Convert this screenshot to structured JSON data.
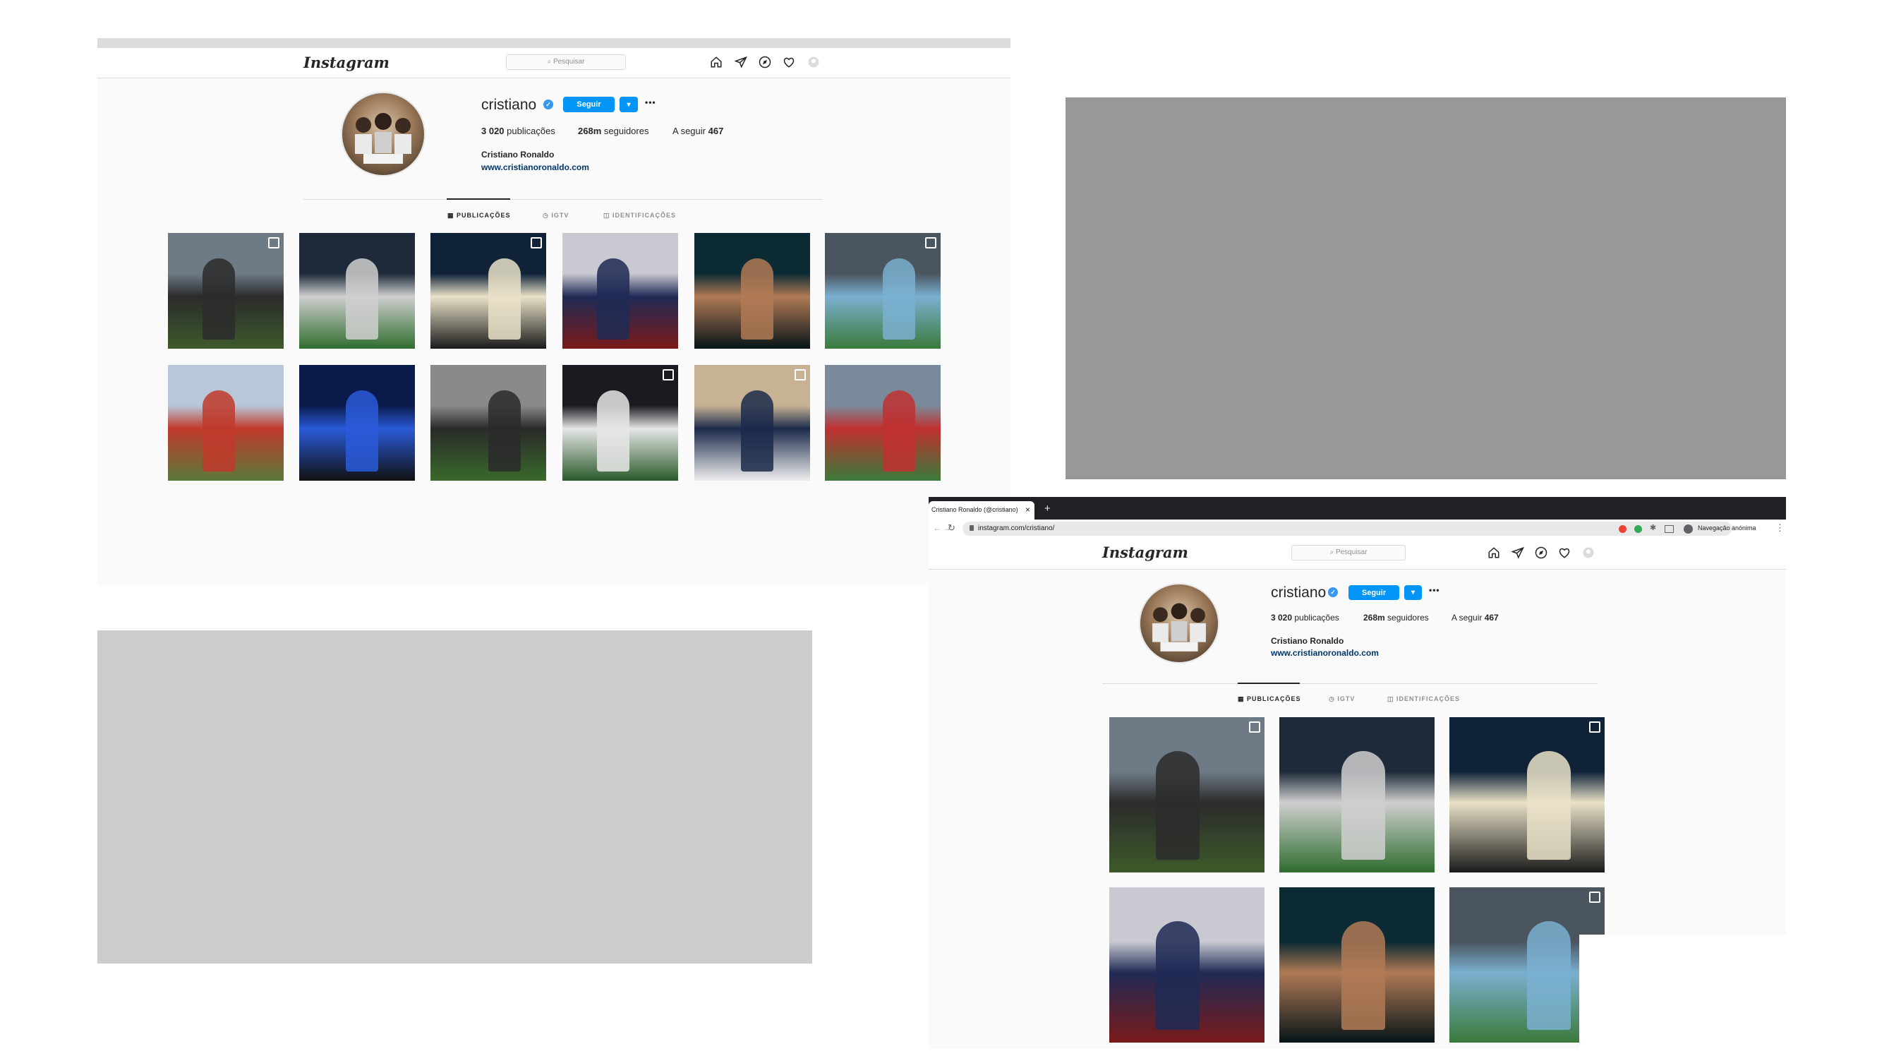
{
  "instagram": {
    "logo": "Instagram",
    "search_placeholder": "⌕ Pesquisar",
    "username": "cristiano",
    "verified_mark": "✓",
    "follow_label": "Seguir",
    "dropdown_glyph": "▾",
    "more_glyph": "•••",
    "stats": {
      "posts_value": "3 020",
      "posts_label": "publicações",
      "followers_value": "268m",
      "followers_label": "seguidores",
      "following_label": "A seguir",
      "following_value": "467"
    },
    "full_name": "Cristiano Ronaldo",
    "website": "www.cristianoronaldo.com",
    "tabs": [
      "▦ PUBLICAÇÕES",
      "◷ IGTV",
      "◫ IDENTIFICAÇÕES"
    ],
    "nav_icons": [
      "home-icon",
      "direct-icon",
      "explore-icon",
      "heart-icon",
      "profile-icon"
    ]
  },
  "browser": {
    "tab_title": "Cristiano Ronaldo (@cristiano)",
    "tab_close": "×",
    "new_tab": "+",
    "url": "instagram.com/cristiano/",
    "incognito_label": "Navegação anónima",
    "menu_glyph": "⋮",
    "back_glyph": "←",
    "forward_glyph": "→",
    "reload_glyph": "↻"
  },
  "colors": {
    "accent": "#0095f6",
    "placeholder_dark": "#989898",
    "placeholder_light": "#cccccc"
  }
}
